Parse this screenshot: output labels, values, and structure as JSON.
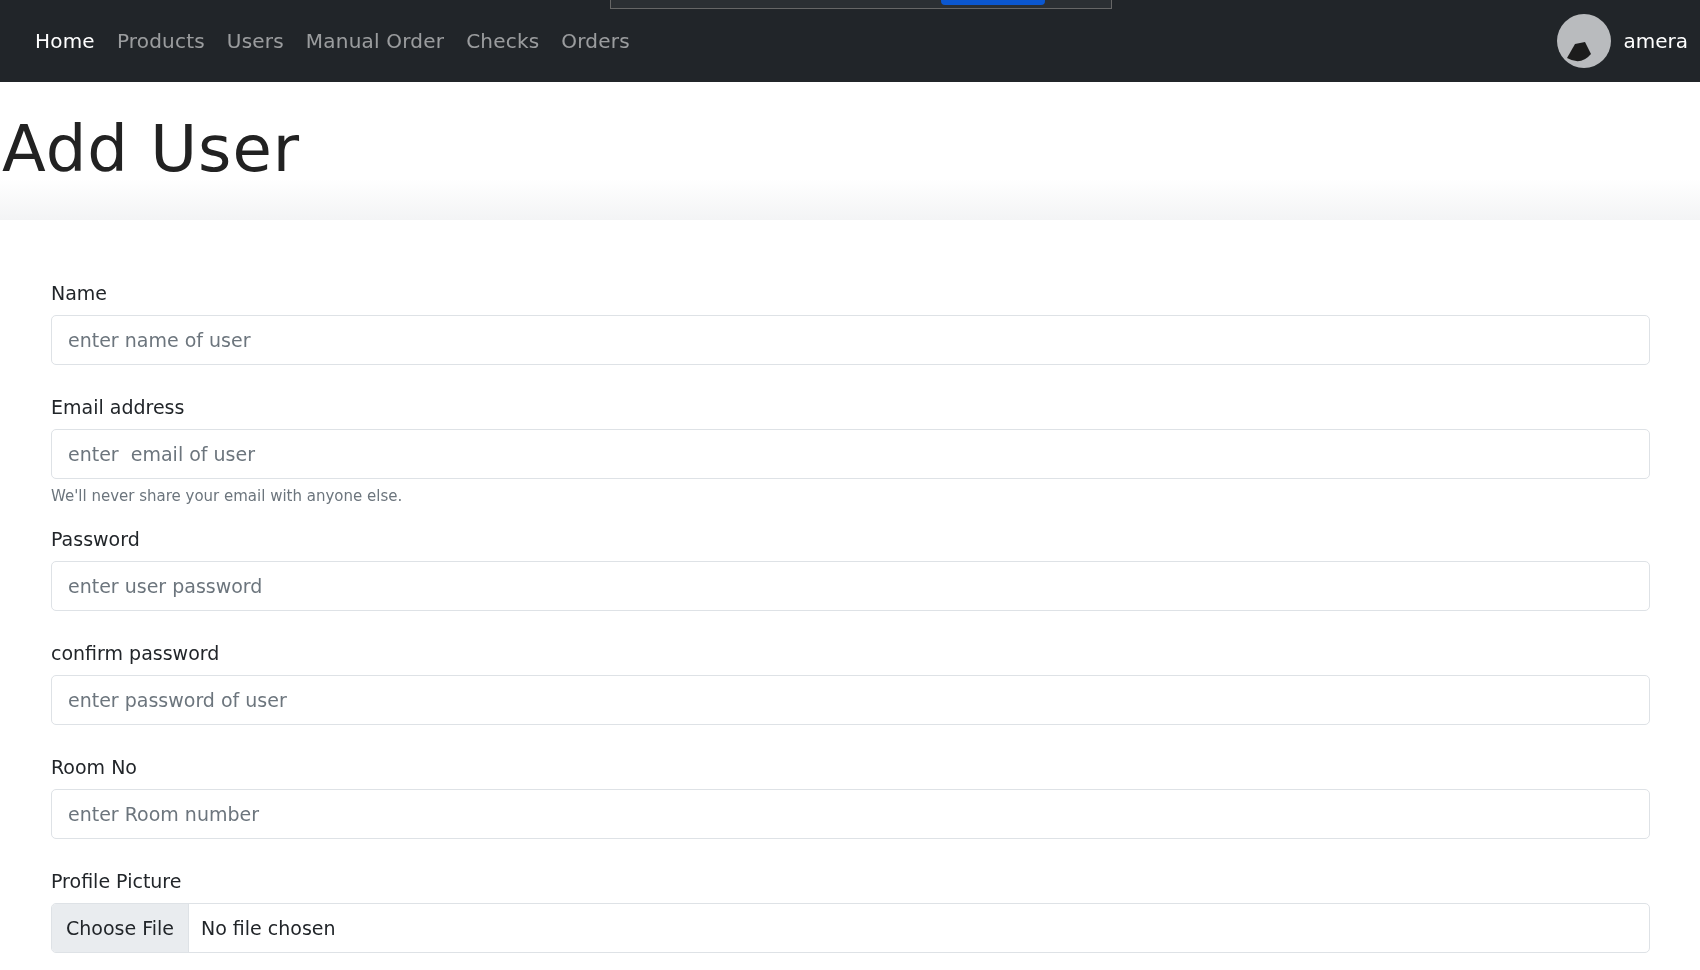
{
  "navbar": {
    "links": [
      {
        "label": "Home",
        "selected": true
      },
      {
        "label": "Products",
        "selected": false
      },
      {
        "label": "Users",
        "selected": false
      },
      {
        "label": "Manual Order",
        "selected": false
      },
      {
        "label": "Checks",
        "selected": false
      },
      {
        "label": "Orders",
        "selected": false
      }
    ],
    "user": {
      "name": "amera"
    }
  },
  "header": {
    "title": "Add User"
  },
  "form": {
    "fields": [
      {
        "kind": "text",
        "label": "Name",
        "placeholder": "enter name of user"
      },
      {
        "kind": "text",
        "label": "Email address",
        "placeholder": "enter  email of user",
        "help": "We'll never share your email with anyone else."
      },
      {
        "kind": "text",
        "label": "Password",
        "placeholder": "enter user password"
      },
      {
        "kind": "text",
        "label": "confirm password",
        "placeholder": "enter password of user"
      },
      {
        "kind": "text",
        "label": "Room No",
        "placeholder": "enter Room number"
      },
      {
        "kind": "file",
        "label": "Profile Picture",
        "button": "Choose File",
        "status": "No file chosen"
      }
    ]
  }
}
